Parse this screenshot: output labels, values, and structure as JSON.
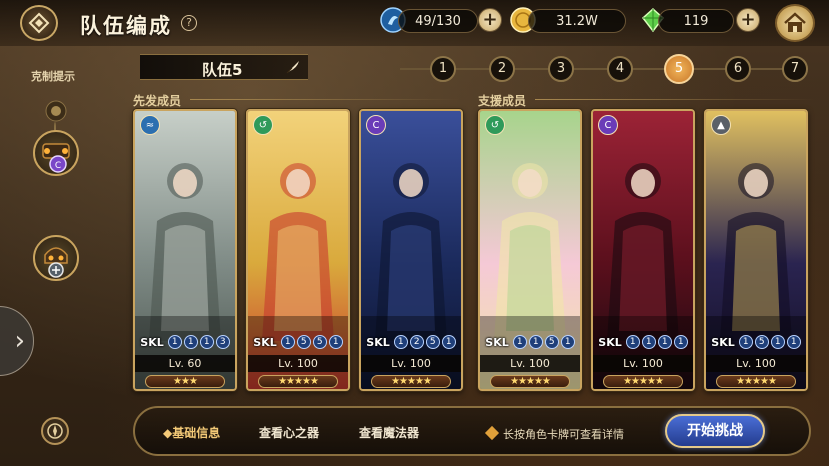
{
  "header": {
    "title": "队伍编成",
    "help_symbol": "?",
    "resources": [
      {
        "icon": "stamina-icon",
        "value": "49/130"
      },
      {
        "icon": "gold-coin-icon",
        "value": "31.2W"
      },
      {
        "icon": "green-gem-icon",
        "value": "119"
      }
    ]
  },
  "sidebar": {
    "hint_label": "克制提示"
  },
  "team": {
    "name": "队伍5",
    "tabs": [
      "1",
      "2",
      "3",
      "4",
      "5",
      "6",
      "7"
    ],
    "active_tab": "5"
  },
  "sections": {
    "starters": "先发成员",
    "support": "支援成员"
  },
  "cards": [
    {
      "element": "water",
      "skl_label": "SKL",
      "skl": [
        "1",
        "1",
        "1",
        "3"
      ],
      "level": "Lv. 60",
      "stars": "★★★",
      "palette": [
        "#7f8b86",
        "#c7cfc8",
        "#4c5650"
      ]
    },
    {
      "element": "wind",
      "skl_label": "SKL",
      "skl": [
        "1",
        "5",
        "5",
        "1"
      ],
      "level": "Lv. 100",
      "stars": "★★★★★",
      "palette": [
        "#d9a93c",
        "#f2d27a",
        "#c83a2e"
      ]
    },
    {
      "element": "dark",
      "skl_label": "SKL",
      "skl": [
        "1",
        "2",
        "5",
        "1"
      ],
      "level": "Lv. 100",
      "stars": "★★★★★",
      "palette": [
        "#1b2a5c",
        "#3a4f9a",
        "#0e1530"
      ]
    },
    {
      "element": "wind",
      "skl_label": "SKL",
      "skl": [
        "1",
        "1",
        "5",
        "1"
      ],
      "level": "Lv. 100",
      "stars": "★★★★★",
      "palette": [
        "#f5c9d6",
        "#a7d48c",
        "#f1e6a8"
      ]
    },
    {
      "element": "dark",
      "skl_label": "SKL",
      "skl": [
        "1",
        "1",
        "1",
        "1"
      ],
      "level": "Lv. 100",
      "stars": "★★★★★",
      "palette": [
        "#5a0f1c",
        "#9c2336",
        "#1a0a10"
      ]
    },
    {
      "element": "light",
      "skl_label": "SKL",
      "skl": [
        "1",
        "5",
        "1",
        "1"
      ],
      "level": "Lv. 100",
      "stars": "★★★★★",
      "palette": [
        "#2a2450",
        "#e0c060",
        "#120e24"
      ]
    }
  ],
  "bottom": {
    "tab_basic": "◆基础信息",
    "tab_heart": "查看心之器",
    "tab_magic": "查看魔法器",
    "hint": "长按角色卡牌可查看详情",
    "start_button": "开始挑战"
  },
  "colors": {
    "accent_gold": "#c9a45f",
    "active_tab": "#e39a3e",
    "start_button": "#2f4fb0"
  }
}
